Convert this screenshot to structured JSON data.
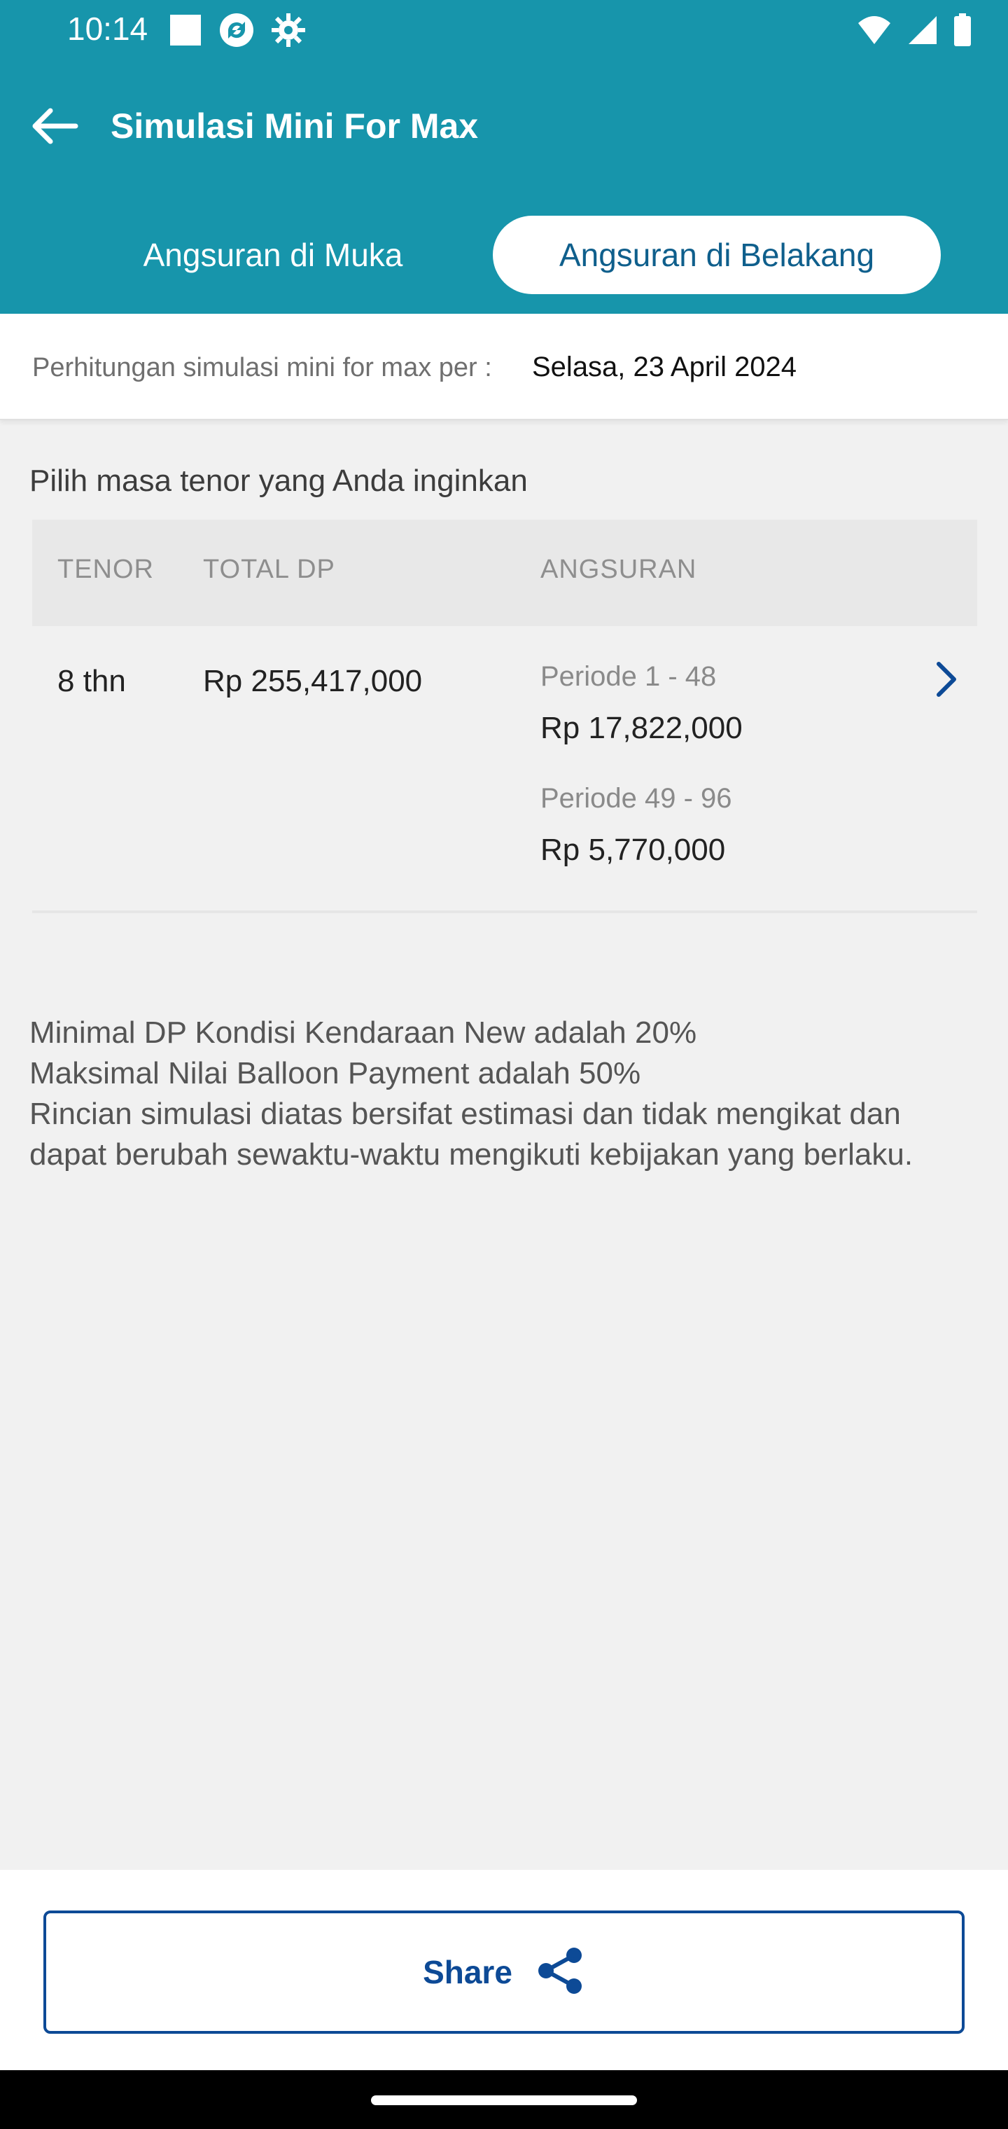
{
  "status_bar": {
    "time": "10:14",
    "left_icons": [
      "square-icon",
      "sync-icon",
      "gear-icon"
    ],
    "right_icons": [
      "wifi-icon",
      "signal-icon",
      "battery-icon"
    ]
  },
  "app_bar": {
    "back_icon": "arrow-left-icon",
    "title": "Simulasi Mini For Max"
  },
  "tabs": [
    {
      "label": "Angsuran di Muka",
      "selected": false
    },
    {
      "label": "Angsuran di Belakang",
      "selected": true
    }
  ],
  "info": {
    "label": "Perhitungan simulasi mini for max per :",
    "date": "Selasa, 23 April 2024"
  },
  "section_title": "Pilih masa tenor yang Anda inginkan",
  "table": {
    "headers": {
      "tenor": "TENOR",
      "total_dp": "TOTAL DP",
      "angsuran": "ANGSURAN"
    },
    "rows": [
      {
        "tenor": "8 thn",
        "total_dp": "Rp 255,417,000",
        "periods": [
          {
            "label": "Periode 1 - 48",
            "value": "Rp 17,822,000"
          },
          {
            "label": "Periode 49 - 96",
            "value": "Rp 5,770,000"
          }
        ]
      }
    ]
  },
  "notes": [
    "Minimal DP Kondisi Kendaraan New adalah 20%",
    "Maksimal Nilai Balloon Payment adalah 50%",
    "Rincian simulasi diatas bersifat estimasi dan tidak mengikat dan dapat berubah sewaktu-waktu mengikuti kebijakan yang berlaku."
  ],
  "share_button": {
    "label": "Share",
    "icon": "share-icon"
  },
  "colors": {
    "header_bg": "#1795ab",
    "accent_blue": "#0d4a96",
    "selected_tab_bg": "#ffffff"
  }
}
